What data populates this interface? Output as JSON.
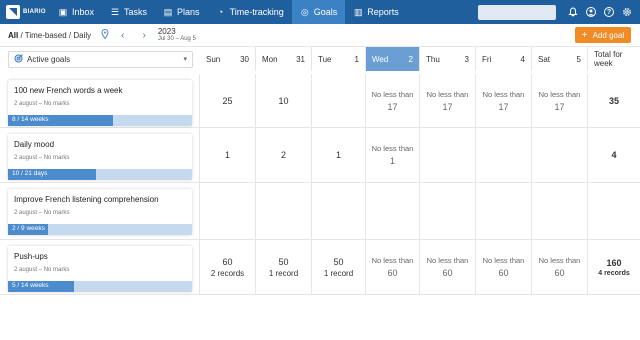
{
  "nav": {
    "brand": "BIARIO",
    "items": [
      {
        "label": "Inbox",
        "icon": "inbox-icon",
        "glyph": "▣",
        "active": false
      },
      {
        "label": "Tasks",
        "icon": "tasks-icon",
        "glyph": "☰",
        "active": false
      },
      {
        "label": "Plans",
        "icon": "plans-icon",
        "glyph": "▤",
        "active": false
      },
      {
        "label": "Time-tracking",
        "icon": "clock-icon",
        "glyph": "◔",
        "active": false
      },
      {
        "label": "Goals",
        "icon": "target-icon",
        "glyph": "◎",
        "active": true
      },
      {
        "label": "Reports",
        "icon": "bar-chart-icon",
        "glyph": "▥",
        "active": false
      }
    ],
    "search_placeholder": ""
  },
  "toolbar": {
    "crumb_all": "All",
    "crumb_rest": " / Time-based / Daily",
    "year": "2023",
    "range": "Jul 30 – Aug 5",
    "add_goal": "Add goal"
  },
  "filter": {
    "label": "Active goals"
  },
  "days": [
    {
      "dow": "Sun",
      "num": "30",
      "today": false
    },
    {
      "dow": "Mon",
      "num": "31",
      "today": false
    },
    {
      "dow": "Tue",
      "num": "1",
      "today": false
    },
    {
      "dow": "Wed",
      "num": "2",
      "today": true
    },
    {
      "dow": "Thu",
      "num": "3",
      "today": false
    },
    {
      "dow": "Fri",
      "num": "4",
      "today": false
    },
    {
      "dow": "Sat",
      "num": "5",
      "today": false
    }
  ],
  "total_header": "Total for week",
  "goals": [
    {
      "title": "100 new French words a week",
      "sub": "2 august – No marks",
      "progress_label": "8 / 14 weeks",
      "progress": 0.57,
      "cells": [
        {
          "value": "25"
        },
        {
          "value": "10"
        },
        {},
        {
          "nlt": "No less than",
          "value": "17"
        },
        {
          "nlt": "No less than",
          "value": "17"
        },
        {
          "nlt": "No less than",
          "value": "17"
        },
        {
          "nlt": "No less than",
          "value": "17"
        }
      ],
      "total": {
        "value": "35"
      }
    },
    {
      "title": "Daily mood",
      "sub": "2 august – No marks",
      "progress_label": "10 / 21 days",
      "progress": 0.48,
      "cells": [
        {
          "value": "1"
        },
        {
          "value": "2"
        },
        {
          "value": "1"
        },
        {
          "nlt": "No less than",
          "value": "1"
        },
        {},
        {},
        {}
      ],
      "total": {
        "value": "4"
      }
    },
    {
      "title": "Improve French listening comprehension",
      "sub": "2 august – No marks",
      "progress_label": "2 / 9 weeks",
      "progress": 0.22,
      "cells": [
        {},
        {},
        {},
        {},
        {},
        {},
        {}
      ],
      "total": {}
    },
    {
      "title": "Push-ups",
      "sub": "2 august – No marks",
      "progress_label": "5 / 14 weeks",
      "progress": 0.36,
      "cells": [
        {
          "value": "60",
          "small": "2 records"
        },
        {
          "value": "50",
          "small": "1 record"
        },
        {
          "value": "50",
          "small": "1 record"
        },
        {
          "nlt": "No less than",
          "value": "60"
        },
        {
          "nlt": "No less than",
          "value": "60"
        },
        {
          "nlt": "No less than",
          "value": "60"
        },
        {
          "nlt": "No less than",
          "value": "60"
        }
      ],
      "total": {
        "value": "160",
        "small": "4 records"
      }
    }
  ]
}
